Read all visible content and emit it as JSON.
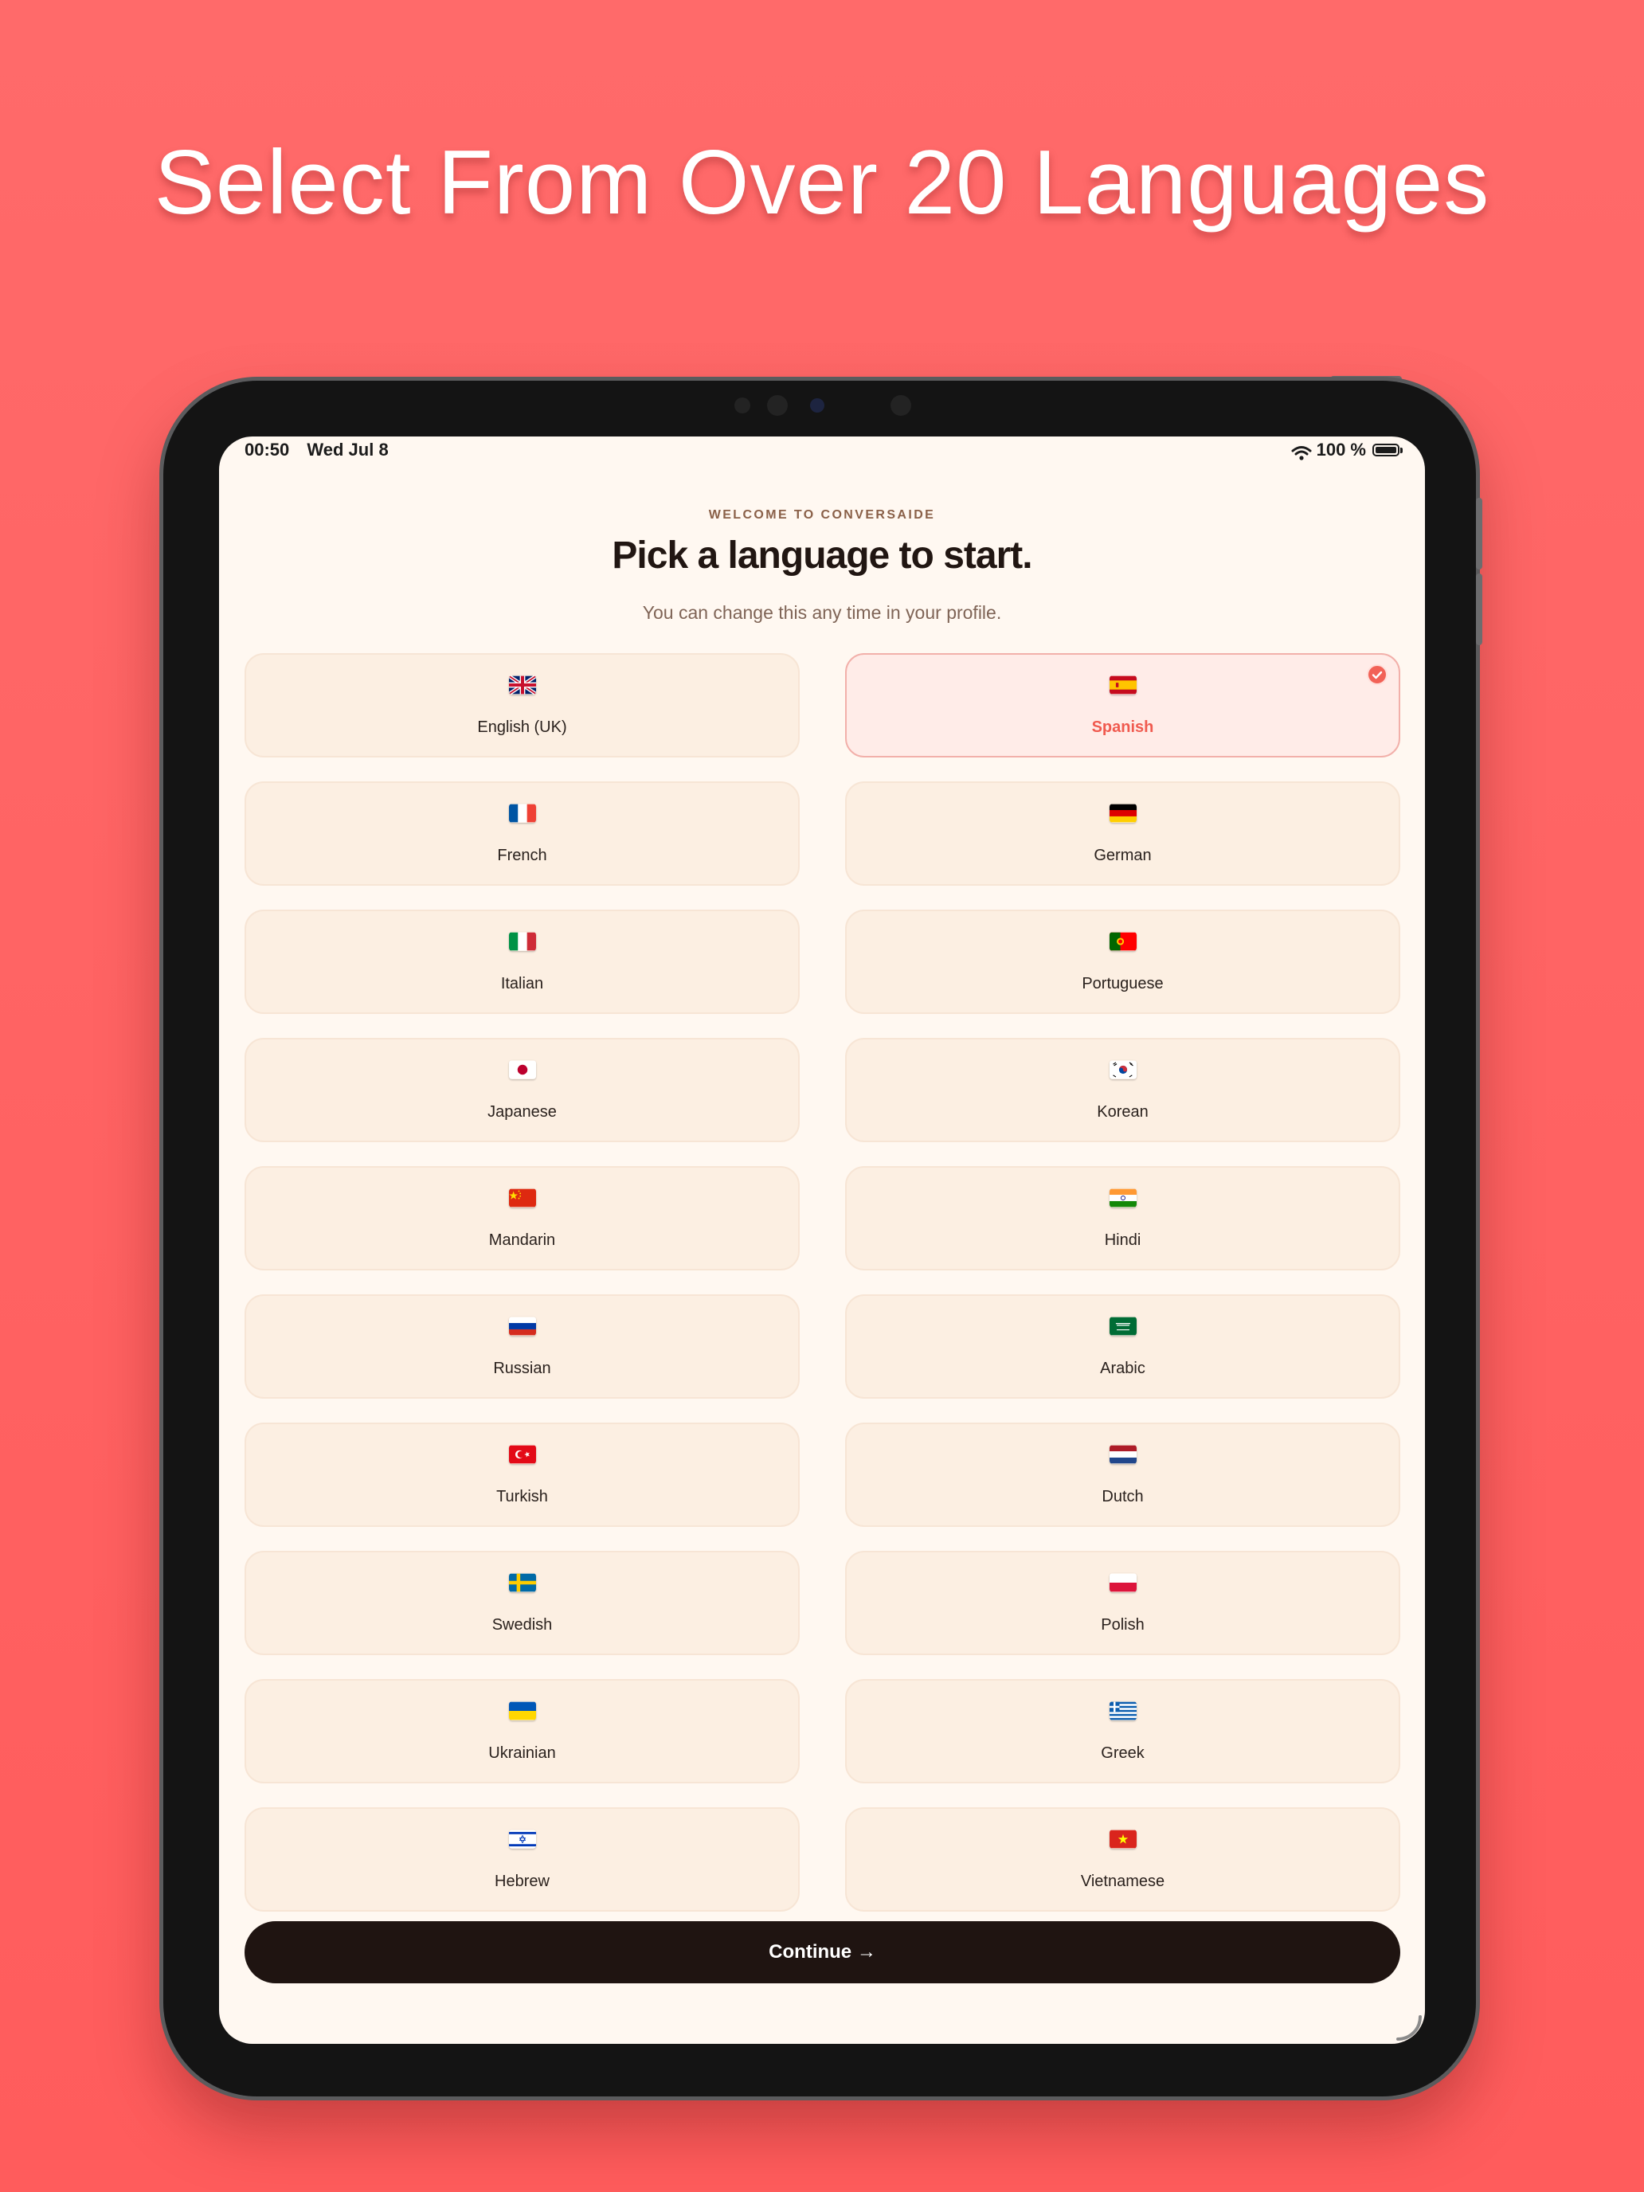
{
  "promo": {
    "headline": "Select From Over 20 Languages"
  },
  "status_bar": {
    "time": "00:50",
    "date": "Wed Jul 8",
    "battery": "100 %"
  },
  "onboarding": {
    "eyebrow": "WELCOME TO CONVERSAIDE",
    "title": "Pick a language to start.",
    "subtitle": "You can change this any time in your profile.",
    "selected_language": "Spanish",
    "continue_label": "Continue →"
  },
  "languages": [
    {
      "label": "English (UK)",
      "flag": "uk-flag-icon"
    },
    {
      "label": "Spanish",
      "flag": "spain-flag-icon",
      "selected": true
    },
    {
      "label": "French",
      "flag": "france-flag-icon"
    },
    {
      "label": "German",
      "flag": "germany-flag-icon"
    },
    {
      "label": "Italian",
      "flag": "italy-flag-icon"
    },
    {
      "label": "Portuguese",
      "flag": "portugal-flag-icon"
    },
    {
      "label": "Japanese",
      "flag": "japan-flag-icon"
    },
    {
      "label": "Korean",
      "flag": "south-korea-flag-icon"
    },
    {
      "label": "Mandarin",
      "flag": "china-flag-icon"
    },
    {
      "label": "Hindi",
      "flag": "india-flag-icon"
    },
    {
      "label": "Russian",
      "flag": "russia-flag-icon"
    },
    {
      "label": "Arabic",
      "flag": "saudi-arabia-flag-icon"
    },
    {
      "label": "Turkish",
      "flag": "turkey-flag-icon"
    },
    {
      "label": "Dutch",
      "flag": "netherlands-flag-icon"
    },
    {
      "label": "Swedish",
      "flag": "sweden-flag-icon"
    },
    {
      "label": "Polish",
      "flag": "poland-flag-icon"
    },
    {
      "label": "Ukrainian",
      "flag": "ukraine-flag-icon"
    },
    {
      "label": "Greek",
      "flag": "greece-flag-icon"
    },
    {
      "label": "Hebrew",
      "flag": "israel-flag-icon"
    },
    {
      "label": "Vietnamese",
      "flag": "vietnam-flag-icon"
    }
  ],
  "colors": {
    "background": "#ff6262",
    "screen": "#fff8f1",
    "card": "#fcefe2",
    "selected_card": "#ffece8",
    "accent": "#f26257",
    "button": "#1f1411"
  }
}
